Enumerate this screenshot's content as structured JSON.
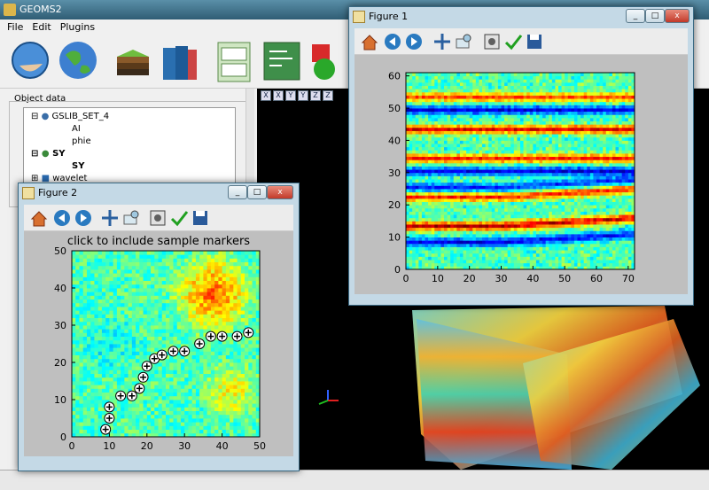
{
  "app": {
    "title": "GEOMS2",
    "menu": [
      "File",
      "Edit",
      "Plugins"
    ],
    "object_data_label": "Object data",
    "tree": [
      {
        "label": "GSLIB_SET_4",
        "children": [
          "AI",
          "phie"
        ]
      },
      {
        "label": "SY",
        "children": [
          "SY"
        ]
      },
      {
        "label": "wavelet",
        "children": []
      }
    ],
    "viewer_tabs": [
      "X",
      "X",
      "Y",
      "Y",
      "Z",
      "Z"
    ]
  },
  "figure1": {
    "title": "Figure 1",
    "controls": {
      "minimize": "_",
      "maximize": "□",
      "close": "x"
    },
    "plot": {
      "type": "heatmap",
      "xticks": [
        "0",
        "10",
        "20",
        "30",
        "40",
        "50",
        "60",
        "70"
      ],
      "yticks": [
        "0",
        "10",
        "20",
        "30",
        "40",
        "50",
        "60"
      ],
      "xlim": [
        0,
        72
      ],
      "ylim": [
        0,
        61
      ]
    }
  },
  "figure2": {
    "title": "Figure 2",
    "controls": {
      "minimize": "_",
      "maximize": "□",
      "close": "x"
    },
    "plot_title": "click to include sample markers",
    "plot": {
      "type": "heatmap",
      "xticks": [
        "0",
        "10",
        "20",
        "30",
        "40",
        "50"
      ],
      "yticks": [
        "0",
        "10",
        "20",
        "30",
        "40",
        "50"
      ],
      "xlim": [
        0,
        50
      ],
      "ylim": [
        0,
        50
      ]
    }
  },
  "chart_data": [
    {
      "type": "heatmap",
      "title": "",
      "xlim": [
        0,
        72
      ],
      "ylim": [
        0,
        61
      ],
      "description_bands_y": [
        8,
        13,
        22,
        25,
        30,
        34,
        43,
        49
      ]
    },
    {
      "type": "scatter",
      "title": "click to include sample markers",
      "xlim": [
        0,
        50
      ],
      "ylim": [
        0,
        50
      ],
      "x": [
        9,
        10,
        10,
        13,
        16,
        18,
        19,
        20,
        22,
        24,
        27,
        30,
        34,
        37,
        40,
        44,
        47
      ],
      "y": [
        2,
        5,
        8,
        11,
        11,
        13,
        16,
        19,
        21,
        22,
        23,
        23,
        25,
        27,
        27,
        27,
        28
      ]
    }
  ]
}
